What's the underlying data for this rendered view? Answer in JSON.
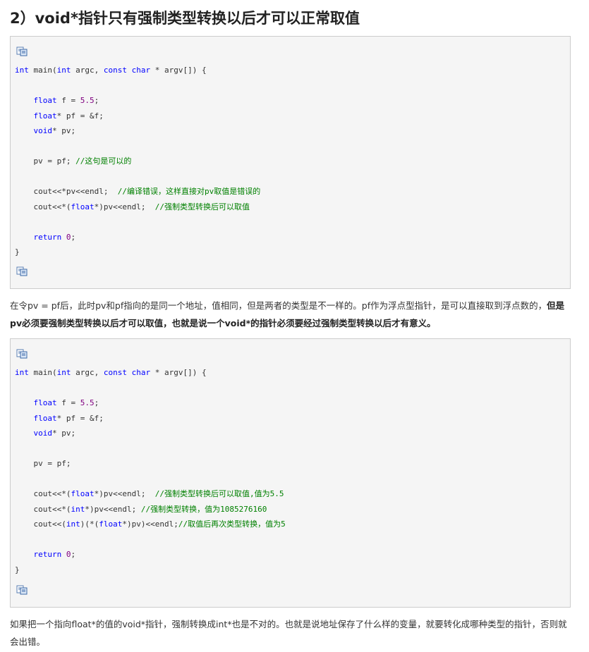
{
  "heading": "2）void*指针只有强制类型转换以后才可以正常取值",
  "icons": {
    "copy": "copy-code-icon"
  },
  "code_block_1": {
    "lines": [
      [
        {
          "t": "int",
          "c": "kw"
        },
        {
          "t": " main("
        },
        {
          "t": "int",
          "c": "kw"
        },
        {
          "t": " argc, "
        },
        {
          "t": "const char",
          "c": "kw"
        },
        {
          "t": " * argv[]) {"
        }
      ],
      [],
      [
        {
          "t": "    "
        },
        {
          "t": "float",
          "c": "kw"
        },
        {
          "t": " f = "
        },
        {
          "t": "5.5",
          "c": "num"
        },
        {
          "t": ";"
        }
      ],
      [
        {
          "t": "    "
        },
        {
          "t": "float",
          "c": "kw"
        },
        {
          "t": "* pf = &f;"
        }
      ],
      [
        {
          "t": "    "
        },
        {
          "t": "void",
          "c": "kw"
        },
        {
          "t": "* pv;"
        }
      ],
      [],
      [
        {
          "t": "    pv = pf; "
        },
        {
          "t": "//这句是可以的",
          "c": "cm"
        }
      ],
      [],
      [
        {
          "t": "    cout<<*pv<<endl;  "
        },
        {
          "t": "//编译错误，这样直接对pv取值是错误的",
          "c": "cm"
        }
      ],
      [
        {
          "t": "    cout<<*("
        },
        {
          "t": "float",
          "c": "kw"
        },
        {
          "t": "*)pv<<endl;  "
        },
        {
          "t": "//强制类型转换后可以取值",
          "c": "cm"
        }
      ],
      [],
      [
        {
          "t": "    "
        },
        {
          "t": "return",
          "c": "kw"
        },
        {
          "t": " "
        },
        {
          "t": "0",
          "c": "num"
        },
        {
          "t": ";"
        }
      ],
      [
        {
          "t": "}"
        }
      ]
    ]
  },
  "paragraph_1": {
    "normal": "在令pv = pf后，此时pv和pf指向的是同一个地址，值相同，但是两者的类型是不一样的。pf作为浮点型指针，是可以直接取到浮点数的，",
    "bold": "但是pv必须要强制类型转换以后才可以取值，也就是说一个void*的指针必须要经过强制类型转换以后才有意义。"
  },
  "code_block_2": {
    "lines": [
      [
        {
          "t": "int",
          "c": "kw"
        },
        {
          "t": " main("
        },
        {
          "t": "int",
          "c": "kw"
        },
        {
          "t": " argc, "
        },
        {
          "t": "const char",
          "c": "kw"
        },
        {
          "t": " * argv[]) {"
        }
      ],
      [],
      [
        {
          "t": "    "
        },
        {
          "t": "float",
          "c": "kw"
        },
        {
          "t": " f = "
        },
        {
          "t": "5.5",
          "c": "num"
        },
        {
          "t": ";"
        }
      ],
      [
        {
          "t": "    "
        },
        {
          "t": "float",
          "c": "kw"
        },
        {
          "t": "* pf = &f;"
        }
      ],
      [
        {
          "t": "    "
        },
        {
          "t": "void",
          "c": "kw"
        },
        {
          "t": "* pv;"
        }
      ],
      [],
      [
        {
          "t": "    pv = pf;"
        }
      ],
      [],
      [
        {
          "t": "    cout<<*("
        },
        {
          "t": "float",
          "c": "kw"
        },
        {
          "t": "*)pv<<endl;  "
        },
        {
          "t": "//强制类型转换后可以取值,值为5.5",
          "c": "cm"
        }
      ],
      [
        {
          "t": "    cout<<*("
        },
        {
          "t": "int",
          "c": "kw"
        },
        {
          "t": "*)pv<<endl; "
        },
        {
          "t": "//强制类型转换，值为1085276160",
          "c": "cm"
        }
      ],
      [
        {
          "t": "    cout<<("
        },
        {
          "t": "int",
          "c": "kw"
        },
        {
          "t": ")(*("
        },
        {
          "t": "float",
          "c": "kw"
        },
        {
          "t": "*)pv)<<endl;"
        },
        {
          "t": "//取值后再次类型转换，值为5",
          "c": "cm"
        }
      ],
      [],
      [
        {
          "t": "    "
        },
        {
          "t": "return",
          "c": "kw"
        },
        {
          "t": " "
        },
        {
          "t": "0",
          "c": "num"
        },
        {
          "t": ";"
        }
      ],
      [
        {
          "t": "}"
        }
      ]
    ]
  },
  "paragraph_2": {
    "normal": "如果把一个指向float*的值的void*指针，强制转换成int*也是不对的。也就是说地址保存了什么样的变量，就要转化成哪种类型的指针，否则就会出错。"
  }
}
